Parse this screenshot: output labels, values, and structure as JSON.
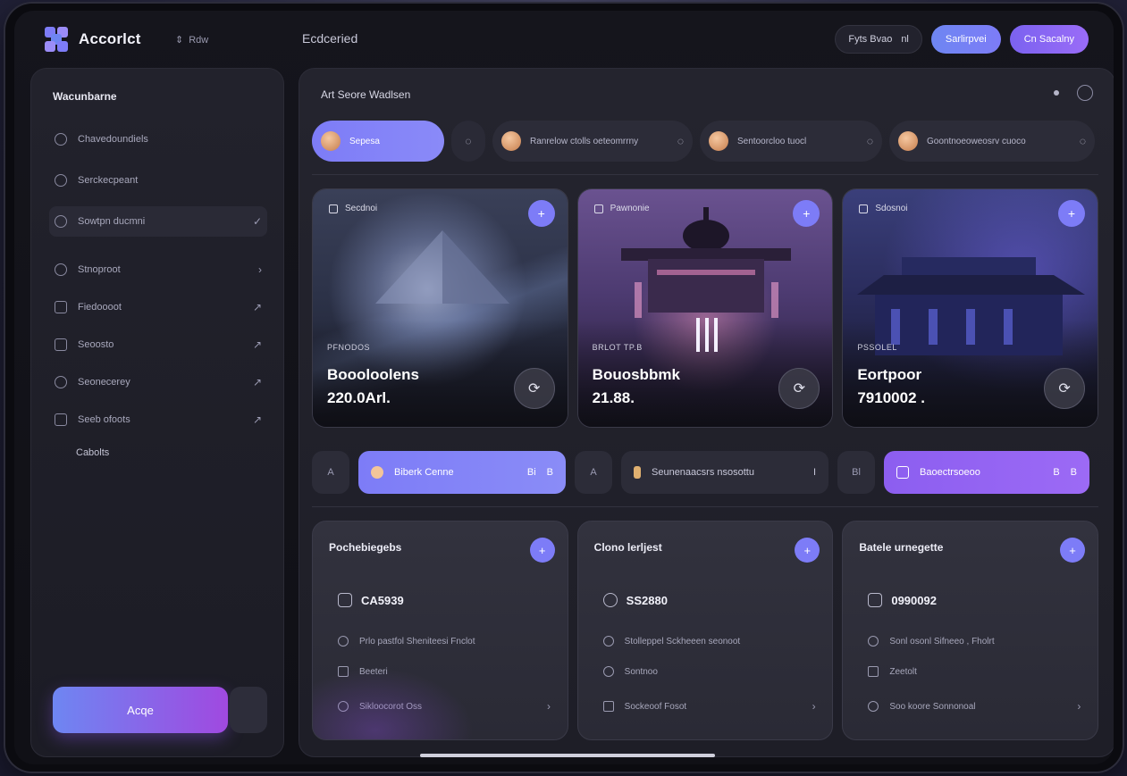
{
  "app": {
    "name": "Accorlct",
    "hint": "Rdw",
    "title": "Ecdceried"
  },
  "top_actions": {
    "chip_label": "Fyts Bvao",
    "chip_suffix": "nl",
    "primary_label": "Sarlirpvei",
    "secondary_label": "Cn Sacalny"
  },
  "sidebar": {
    "title": "Wacunbarne",
    "items": [
      {
        "label": "Chavedoundiels",
        "trail": ""
      },
      {
        "label": "Serckecpeant",
        "trail": ""
      },
      {
        "label": "Sowtpn ducmni",
        "trail": "✓"
      },
      {
        "label": "Stnoproot",
        "trail": "›"
      },
      {
        "label": "Fiedoooot",
        "trail": "↗"
      },
      {
        "label": "Seoosto",
        "trail": "↗"
      },
      {
        "label": "Seonecerey",
        "trail": "↗"
      },
      {
        "label": "Seeb ofoots",
        "trail": "↗"
      }
    ],
    "sub_label": "Cabolts",
    "cta_label": "Acqe"
  },
  "main": {
    "title": "Art Seore Wadlsen",
    "pills": [
      {
        "label": "Sepesa",
        "active": true
      },
      {
        "label": "Ranrelow ctolls oeteomrrny",
        "active": false
      },
      {
        "label": "Sentoorcloo tuocl",
        "active": false
      },
      {
        "label": "Goontnoeoweosrv cuoco",
        "active": false
      }
    ],
    "cards": [
      {
        "tag": "Secdnoi",
        "sub": "PFNODOS",
        "name": "Boooloolens",
        "value": "220.0Arl."
      },
      {
        "tag": "Pawnonie",
        "sub": "BRLOT TP.B",
        "name": "Bouosbbmk",
        "value": "21.88."
      },
      {
        "tag": "Sdosnoi",
        "sub": "PSSOLEL",
        "name": "Eortpoor",
        "value": "7910002 ."
      }
    ],
    "filters": [
      {
        "prefix": "A",
        "label": "Biberk Cenne",
        "num": "Bi",
        "tail": "B",
        "style": "blue"
      },
      {
        "prefix": "A",
        "label": "Seunenaacsrs nsosottu",
        "num": "",
        "tail": "I",
        "style": "dark"
      },
      {
        "prefix": "Bl",
        "label": "Baoectrsoeoo",
        "num": "B",
        "tail": "B",
        "style": "violet"
      }
    ],
    "infos": [
      {
        "title": "Pochebiegebs",
        "main": "CA5939",
        "lines": [
          "Prlo pastfol Sheniteesi Fnclot",
          "Beeteri",
          "Sikloocorot Oss"
        ]
      },
      {
        "title": "Clono lerljest",
        "main": "SS2880",
        "lines": [
          "Stolleppel Sckheeen seonoot",
          "Sontnoo",
          "Sockeoof Fosot"
        ]
      },
      {
        "title": "Batele urnegette",
        "main": "0990092",
        "lines": [
          "Sonl osonl Sifneeo , Fholrt",
          "Zeetolt",
          "Soo koore Sonnonoal"
        ]
      }
    ]
  }
}
